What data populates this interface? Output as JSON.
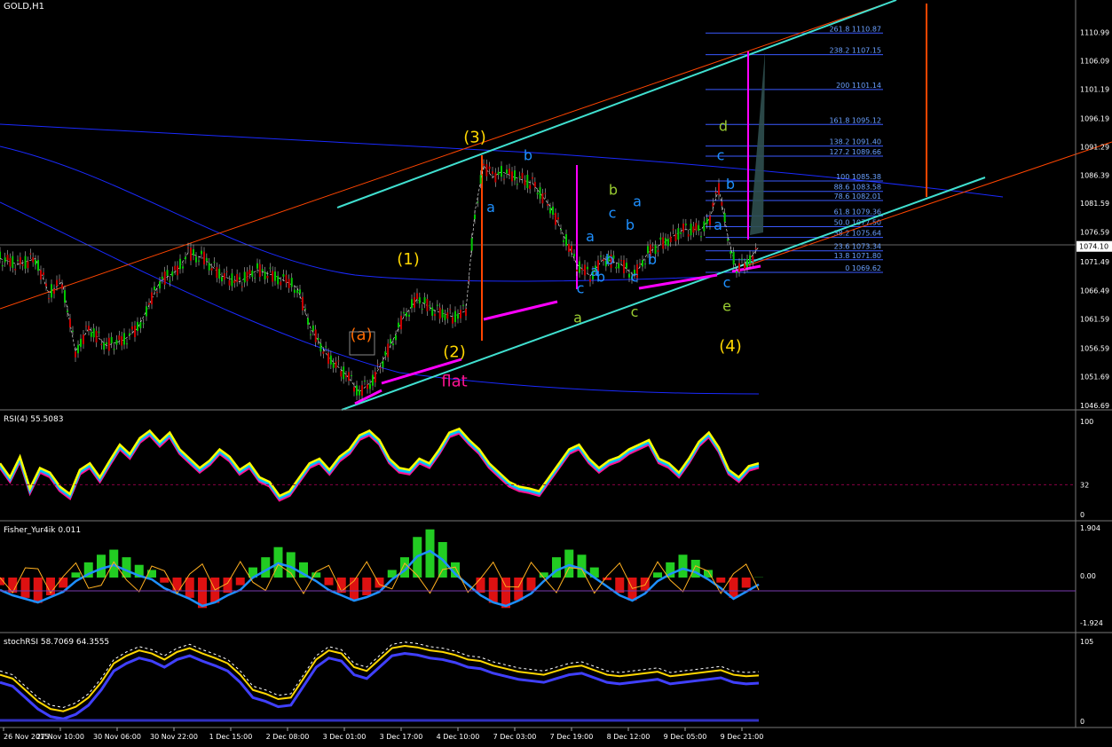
{
  "chart_data": [
    {
      "type": "candlestick",
      "title": "GOLD,H1",
      "ylim": [
        1046.69,
        1115.65
      ],
      "y_ticks": [
        "1110.99",
        "1106.09",
        "1101.19",
        "1096.19",
        "1091.29",
        "1086.39",
        "1081.59",
        "1076.59",
        "1071.49",
        "1066.49",
        "1061.59",
        "1056.59",
        "1051.69",
        "1046.69"
      ],
      "current_price": "1074.10",
      "x_labels": [
        "26 Nov 2015",
        "27 Nov 10:00",
        "30 Nov 06:00",
        "30 Nov 22:00",
        "1 Dec 15:00",
        "2 Dec 08:00",
        "3 Dec 01:00",
        "3 Dec 17:00",
        "4 Dec 10:00",
        "7 Dec 03:00",
        "7 Dec 19:00",
        "8 Dec 12:00",
        "9 Dec 05:00",
        "9 Dec 21:00"
      ],
      "price_path": [
        [
          0,
          1072
        ],
        [
          20,
          1071
        ],
        [
          40,
          1072
        ],
        [
          55,
          1066
        ],
        [
          70,
          1068
        ],
        [
          85,
          1056
        ],
        [
          100,
          1060
        ],
        [
          120,
          1057
        ],
        [
          140,
          1058
        ],
        [
          155,
          1060
        ],
        [
          165,
          1063
        ],
        [
          180,
          1068
        ],
        [
          200,
          1070
        ],
        [
          212,
          1073
        ],
        [
          230,
          1072
        ],
        [
          250,
          1069
        ],
        [
          270,
          1068
        ],
        [
          290,
          1070
        ],
        [
          310,
          1069
        ],
        [
          335,
          1067
        ],
        [
          350,
          1060
        ],
        [
          370,
          1055
        ],
        [
          390,
          1052
        ],
        [
          405,
          1049
        ],
        [
          420,
          1051
        ],
        [
          440,
          1057
        ],
        [
          455,
          1062
        ],
        [
          470,
          1065
        ],
        [
          490,
          1063
        ],
        [
          510,
          1062
        ],
        [
          525,
          1063
        ],
        [
          535,
          1080
        ],
        [
          545,
          1088
        ],
        [
          555,
          1086
        ],
        [
          565,
          1087
        ],
        [
          580,
          1086
        ],
        [
          600,
          1085
        ],
        [
          620,
          1081
        ],
        [
          635,
          1076
        ],
        [
          650,
          1071
        ],
        [
          665,
          1069
        ],
        [
          680,
          1072
        ],
        [
          700,
          1071
        ],
        [
          715,
          1069
        ],
        [
          730,
          1073
        ],
        [
          750,
          1075
        ],
        [
          770,
          1077
        ],
        [
          790,
          1077
        ],
        [
          800,
          1079
        ],
        [
          810,
          1084
        ],
        [
          820,
          1076
        ],
        [
          830,
          1070
        ],
        [
          845,
          1072
        ],
        [
          855,
          1074
        ]
      ],
      "fib_levels": [
        {
          "label": "261.8 1110.87",
          "value": 1110.87
        },
        {
          "label": "238.2 1107.15",
          "value": 1107.15
        },
        {
          "label": "200 1101.14",
          "value": 1101.14
        },
        {
          "label": "161.8 1095.12",
          "value": 1095.12
        },
        {
          "label": "138.2 1091.40",
          "value": 1091.4
        },
        {
          "label": "127.2 1089.66",
          "value": 1089.66
        },
        {
          "label": "100 1085.38",
          "value": 1085.38
        },
        {
          "label": "88.6 1083.58",
          "value": 1083.58
        },
        {
          "label": "78.6 1082.01",
          "value": 1082.01
        },
        {
          "label": "61.8 1079.36",
          "value": 1079.36
        },
        {
          "label": "50.0 1077.50",
          "value": 1077.5
        },
        {
          "label": "38.2 1075.64",
          "value": 1075.64
        },
        {
          "label": "23.6 1073.34",
          "value": 1073.34
        },
        {
          "label": "13.8 1071.80",
          "value": 1071.8
        },
        {
          "label": "0 1069.62",
          "value": 1069.62
        }
      ],
      "wave_labels": [
        {
          "text": "(3)",
          "color": "#ffd700",
          "x": 535,
          "y": 1092
        },
        {
          "text": "(1)",
          "color": "#ffd700",
          "x": 460,
          "y": 1071
        },
        {
          "text": "(2)",
          "color": "#ffd700",
          "x": 512,
          "y": 1055
        },
        {
          "text": "(4)",
          "color": "#ffd700",
          "x": 823,
          "y": 1056
        },
        {
          "text": "(a)",
          "color": "#ff6a00",
          "x": 407,
          "y": 1058
        },
        {
          "text": "flat",
          "color": "#ff1493",
          "x": 512,
          "y": 1050
        },
        {
          "text": "b",
          "color": "#1e90ff",
          "x": 595,
          "y": 1089
        },
        {
          "text": "a",
          "color": "#1e90ff",
          "x": 553,
          "y": 1080
        },
        {
          "text": "a",
          "color": "#1e90ff",
          "x": 665,
          "y": 1075
        },
        {
          "text": "c",
          "color": "#1e90ff",
          "x": 690,
          "y": 1079
        },
        {
          "text": "a",
          "color": "#1e90ff",
          "x": 718,
          "y": 1081
        },
        {
          "text": "b",
          "color": "#1e90ff",
          "x": 710,
          "y": 1077
        },
        {
          "text": "b",
          "color": "#1e90ff",
          "x": 687,
          "y": 1071
        },
        {
          "text": "a",
          "color": "#1e90ff",
          "x": 670,
          "y": 1069
        },
        {
          "text": "b",
          "color": "#1e90ff",
          "x": 735,
          "y": 1071
        },
        {
          "text": "c",
          "color": "#1e90ff",
          "x": 654,
          "y": 1066
        },
        {
          "text": "b",
          "color": "#1e90ff",
          "x": 677,
          "y": 1068
        },
        {
          "text": "c",
          "color": "#1e90ff",
          "x": 715,
          "y": 1068
        },
        {
          "text": "c",
          "color": "#1e90ff",
          "x": 812,
          "y": 1089
        },
        {
          "text": "b",
          "color": "#1e90ff",
          "x": 823,
          "y": 1084
        },
        {
          "text": "a",
          "color": "#1e90ff",
          "x": 809,
          "y": 1077
        },
        {
          "text": "c",
          "color": "#1e90ff",
          "x": 819,
          "y": 1067
        },
        {
          "text": "b",
          "color": "#9acd32",
          "x": 691,
          "y": 1083
        },
        {
          "text": "d",
          "color": "#9acd32",
          "x": 815,
          "y": 1094
        },
        {
          "text": "a",
          "color": "#9acd32",
          "x": 651,
          "y": 1061
        },
        {
          "text": "c",
          "color": "#9acd32",
          "x": 715,
          "y": 1062
        },
        {
          "text": "e",
          "color": "#9acd32",
          "x": 819,
          "y": 1063
        }
      ]
    },
    {
      "type": "line",
      "title": "RSI(4) 55.5083",
      "ylim": [
        0,
        100
      ],
      "y_ticks": [
        "100",
        "32",
        "0"
      ],
      "level": 32,
      "values": [
        55,
        40,
        62,
        28,
        50,
        45,
        30,
        22,
        48,
        55,
        40,
        58,
        75,
        65,
        82,
        90,
        78,
        88,
        70,
        60,
        50,
        58,
        70,
        62,
        48,
        55,
        40,
        35,
        20,
        25,
        40,
        55,
        60,
        48,
        62,
        70,
        85,
        90,
        80,
        60,
        50,
        48,
        60,
        55,
        70,
        88,
        92,
        80,
        70,
        55,
        45,
        35,
        30,
        28,
        25,
        40,
        55,
        70,
        75,
        60,
        50,
        58,
        62,
        70,
        75,
        80,
        60,
        55,
        45,
        60,
        78,
        88,
        72,
        48,
        40,
        52,
        55
      ]
    },
    {
      "type": "histogram",
      "title": "Fisher_Yur4ik 0.011",
      "ylim": [
        -1.924,
        1.904
      ],
      "y_ticks": [
        "1.904",
        "0.00",
        "-1.924"
      ],
      "values": [
        -0.3,
        -0.6,
        -0.8,
        -1.0,
        -0.7,
        -0.4,
        0.2,
        0.6,
        0.9,
        1.1,
        0.8,
        0.5,
        0.3,
        -0.2,
        -0.5,
        -0.8,
        -1.2,
        -1.0,
        -0.6,
        -0.3,
        0.4,
        0.8,
        1.2,
        1.0,
        0.6,
        0.2,
        -0.3,
        -0.6,
        -0.9,
        -0.7,
        -0.4,
        0.3,
        0.8,
        1.6,
        1.9,
        1.4,
        0.6,
        0.0,
        -0.6,
        -1.0,
        -1.2,
        -0.9,
        -0.5,
        0.2,
        0.8,
        1.1,
        0.9,
        0.4,
        -0.1,
        -0.6,
        -0.9,
        -0.5,
        0.2,
        0.6,
        0.9,
        0.7,
        0.3,
        -0.2,
        -0.8,
        -0.4,
        0.01
      ]
    },
    {
      "type": "line",
      "title": "stochRSI 58.7069 64.3555",
      "ylim": [
        0,
        105
      ],
      "y_ticks": [
        "105",
        "0"
      ],
      "values": [
        60,
        55,
        40,
        25,
        15,
        12,
        18,
        30,
        50,
        75,
        85,
        92,
        88,
        80,
        90,
        95,
        88,
        82,
        75,
        60,
        40,
        35,
        28,
        30,
        55,
        80,
        92,
        88,
        70,
        65,
        80,
        95,
        98,
        96,
        92,
        90,
        86,
        80,
        78,
        72,
        68,
        64,
        62,
        60,
        65,
        70,
        72,
        66,
        60,
        58,
        60,
        62,
        64,
        58,
        60,
        62,
        64,
        66,
        60,
        58,
        59
      ]
    }
  ]
}
